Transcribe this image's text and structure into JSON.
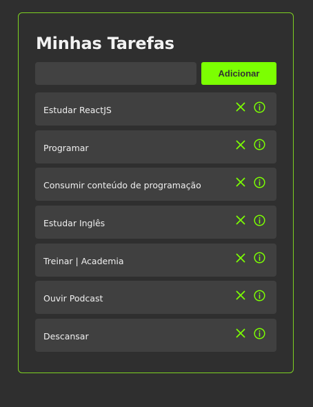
{
  "header": {
    "title": "Minhas Tarefas"
  },
  "form": {
    "input_value": "",
    "input_placeholder": "",
    "add_label": "Adicionar"
  },
  "tasks": [
    {
      "label": "Estudar ReactJS"
    },
    {
      "label": "Programar"
    },
    {
      "label": "Consumir conteúdo de programação"
    },
    {
      "label": "Estudar Inglês"
    },
    {
      "label": "Treinar | Academia"
    },
    {
      "label": "Ouvir Podcast"
    },
    {
      "label": "Descansar"
    }
  ],
  "icons": {
    "remove": "close-icon",
    "details": "info-icon"
  },
  "colors": {
    "accent": "#7cff02",
    "border": "#7ed321",
    "background": "#2f2f2f",
    "item_background": "#404040",
    "text": "#f0f0f0"
  }
}
